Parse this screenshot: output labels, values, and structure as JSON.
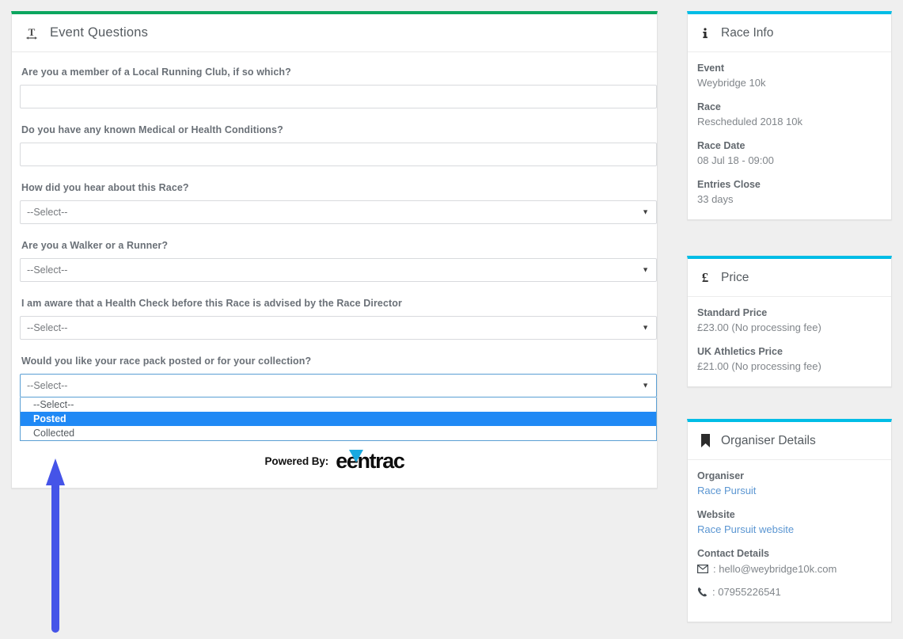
{
  "main": {
    "header": {
      "icon": "text-format-icon",
      "title": "Event Questions"
    },
    "questions": [
      {
        "label": "Are you a member of a Local Running Club, if so which?",
        "type": "text",
        "value": "",
        "placeholder": ""
      },
      {
        "label": "Do you have any known Medical or Health Conditions?",
        "type": "text",
        "value": "",
        "placeholder": ""
      },
      {
        "label": "How did you hear about this Race?",
        "type": "select",
        "value": "--Select--"
      },
      {
        "label": "Are you a Walker or a Runner?",
        "type": "select",
        "value": "--Select--"
      },
      {
        "label": "I am aware that a Health Check before this Race is advised by the Race Director",
        "type": "select",
        "value": "--Select--"
      },
      {
        "label": "Would you like your race pack posted or for your collection?",
        "type": "select-open",
        "value": "--Select--",
        "options": [
          "--Select--",
          "Posted",
          "Collected"
        ],
        "highlighted": "Posted"
      }
    ],
    "caret": "▼",
    "powered": {
      "text": "Powered By:",
      "brand_pre": "e",
      "brand_post": "entrac"
    }
  },
  "race_info": {
    "icon": "info-icon",
    "title": "Race Info",
    "rows": [
      {
        "label": "Event",
        "value": "Weybridge 10k"
      },
      {
        "label": "Race",
        "value": "Rescheduled 2018 10k"
      },
      {
        "label": "Race Date",
        "value": "08 Jul 18 - 09:00"
      },
      {
        "label": "Entries Close",
        "value": "33 days"
      }
    ]
  },
  "price": {
    "icon": "pound-icon",
    "icon_glyph": "£",
    "title": "Price",
    "rows": [
      {
        "label": "Standard Price",
        "value": "£23.00 (No processing fee)"
      },
      {
        "label": "UK Athletics Price",
        "value": "£21.00 (No processing fee)"
      }
    ]
  },
  "organiser": {
    "icon": "bookmark-icon",
    "title": "Organiser Details",
    "rows": [
      {
        "label": "Organiser",
        "value": "Race Pursuit",
        "link": true
      },
      {
        "label": "Website",
        "value": "Race Pursuit website",
        "link": true
      }
    ],
    "contact_label": "Contact Details",
    "email": ": hello@weybridge10k.com",
    "phone": ": 07955226541"
  },
  "annotation": {
    "type": "arrow-up",
    "color": "#4554e8"
  },
  "colors": {
    "page_bg": "#efefef",
    "main_accent": "#0ca65f",
    "card_accent": "#00bde6",
    "option_highlight": "#2089f5",
    "link": "#5b96d2",
    "arrow": "#4554e8"
  }
}
